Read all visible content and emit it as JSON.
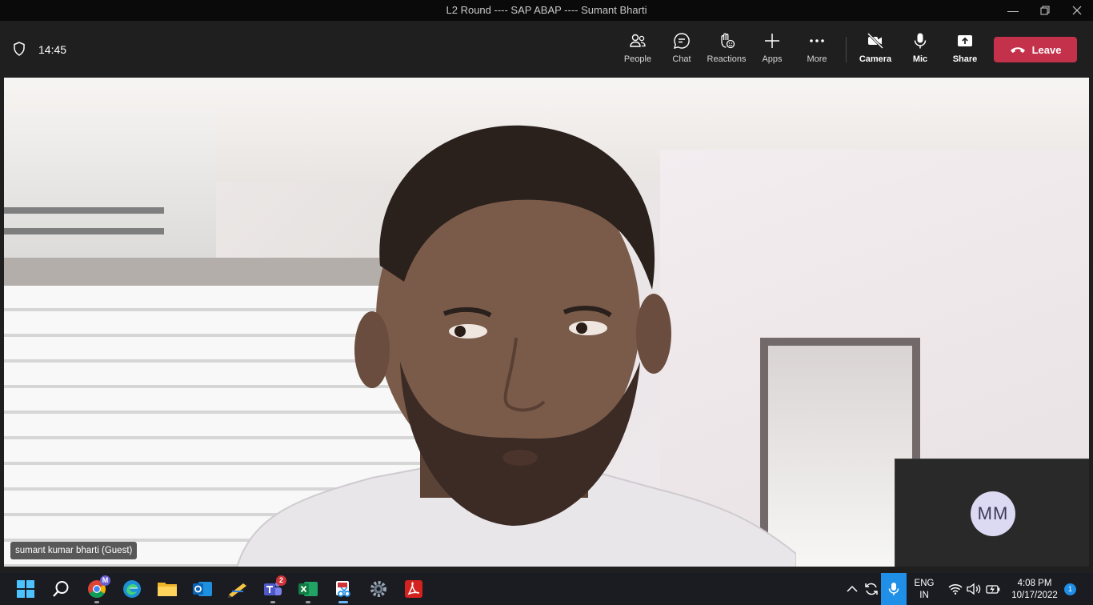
{
  "window": {
    "title": "L2 Round ---- SAP ABAP ---- Sumant Bharti"
  },
  "meeting": {
    "timer": "14:45",
    "toolbar": [
      {
        "id": "people",
        "label": "People"
      },
      {
        "id": "chat",
        "label": "Chat"
      },
      {
        "id": "reactions",
        "label": "Reactions"
      },
      {
        "id": "apps",
        "label": "Apps"
      },
      {
        "id": "more",
        "label": "More"
      },
      {
        "id": "camera",
        "label": "Camera"
      },
      {
        "id": "mic",
        "label": "Mic"
      },
      {
        "id": "share",
        "label": "Share"
      }
    ],
    "leave_label": "Leave",
    "participant_name": "sumant kumar bharti (Guest)",
    "self_initials": "MM"
  },
  "taskbar": {
    "chrome_badge": "M",
    "teams_badge": "2",
    "language": "ENG",
    "region": "IN",
    "time": "4:08 PM",
    "date": "10/17/2022",
    "notifications": "1"
  },
  "colors": {
    "leave": "#c4314b",
    "accent": "#1f8fe8",
    "avatar_bg": "#dcd9f2"
  }
}
